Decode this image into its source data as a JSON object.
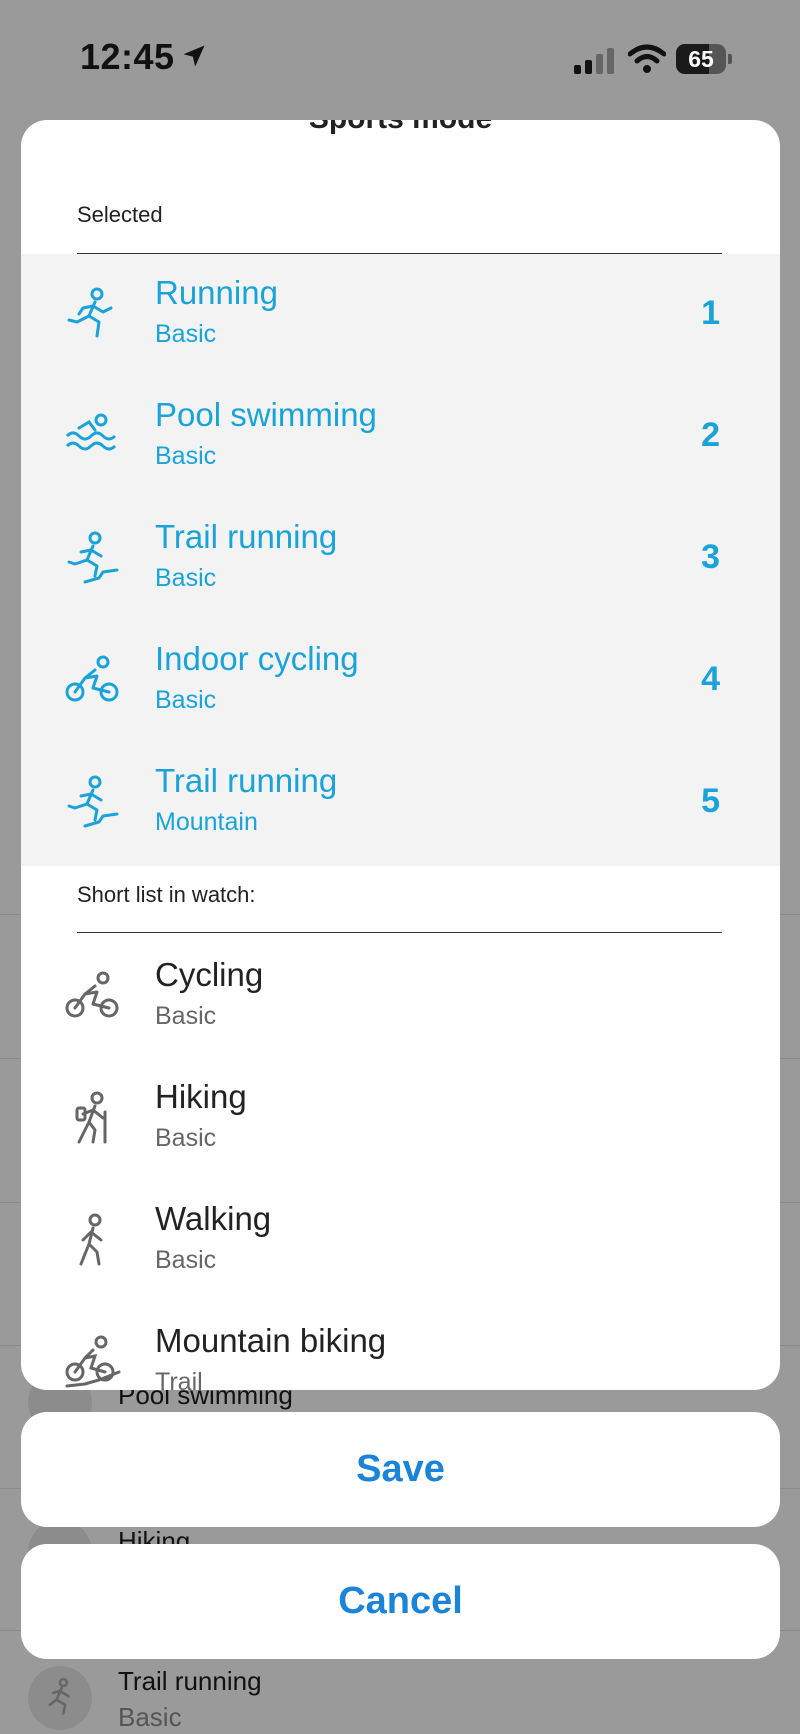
{
  "status_bar": {
    "time": "12:45",
    "battery": "65",
    "battery_level": 0.65
  },
  "background_list": {
    "items": [
      {
        "label": "Pool swimming"
      },
      {
        "label": "Hiking"
      },
      {
        "label": "Trail running",
        "sub": "Basic"
      }
    ]
  },
  "sheet": {
    "title": "Sports mode",
    "selected_label": "Selected",
    "selected": [
      {
        "name": "Running",
        "sub": "Basic",
        "index": "1",
        "icon": "running-icon"
      },
      {
        "name": "Pool swimming",
        "sub": "Basic",
        "index": "2",
        "icon": "swimming-icon"
      },
      {
        "name": "Trail running",
        "sub": "Basic",
        "index": "3",
        "icon": "trail-running-icon"
      },
      {
        "name": "Indoor cycling",
        "sub": "Basic",
        "index": "4",
        "icon": "cycling-icon"
      },
      {
        "name": "Trail running",
        "sub": "Mountain",
        "index": "5",
        "icon": "trail-running-icon"
      }
    ],
    "shortlist_label": "Short list in watch:",
    "shortlist": [
      {
        "name": "Cycling",
        "sub": "Basic",
        "icon": "cycling-icon"
      },
      {
        "name": "Hiking",
        "sub": "Basic",
        "icon": "hiking-icon"
      },
      {
        "name": "Walking",
        "sub": "Basic",
        "icon": "walking-icon"
      },
      {
        "name": "Mountain biking",
        "sub": "Trail",
        "icon": "mountain-biking-icon"
      }
    ]
  },
  "actions": {
    "save": "Save",
    "cancel": "Cancel"
  },
  "colors": {
    "accent": "#19a3d9",
    "button_text": "#1a84d8",
    "dim": "#9a9a9a",
    "selected_bg": "#f3f3f3"
  }
}
